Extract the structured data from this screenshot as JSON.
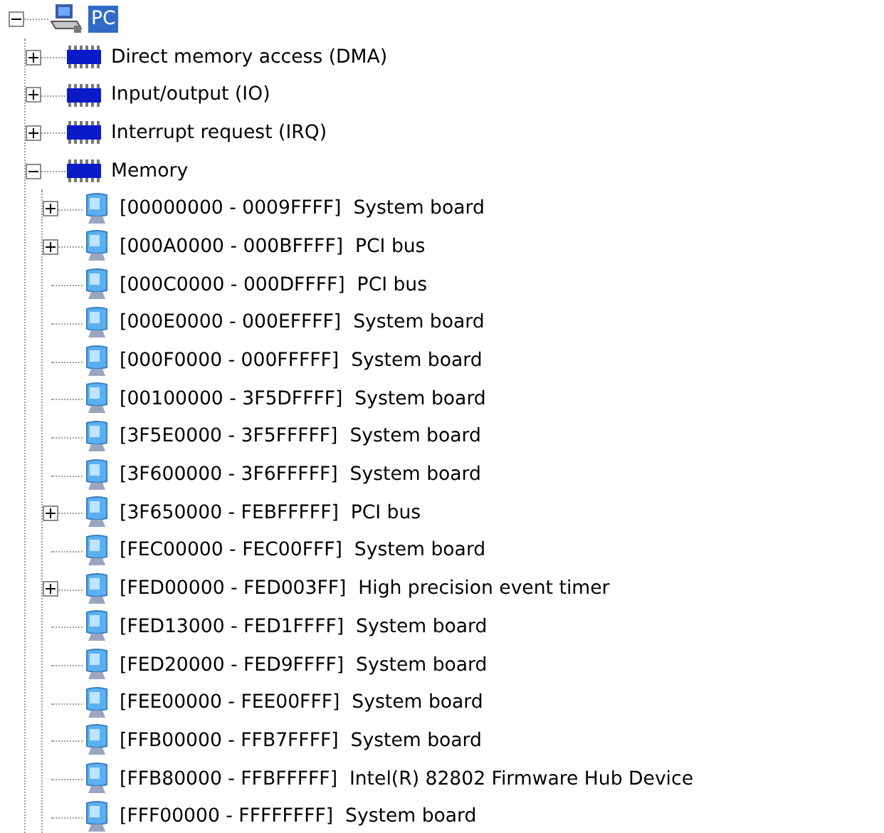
{
  "tree": [
    {
      "kind": "computer",
      "label": "PC",
      "selected": true,
      "expanded": true,
      "children": [
        {
          "kind": "category",
          "label": "Direct memory access (DMA)",
          "selected": false,
          "expanded": false
        },
        {
          "kind": "category",
          "label": "Input/output (IO)",
          "selected": false,
          "expanded": false
        },
        {
          "kind": "category",
          "label": "Interrupt request (IRQ)",
          "selected": false,
          "expanded": false
        },
        {
          "kind": "category",
          "label": "Memory",
          "selected": false,
          "expanded": true,
          "children": [
            {
              "kind": "resource",
              "label": "[00000000 - 0009FFFF]  System board",
              "selected": false,
              "expanded": false
            },
            {
              "kind": "resource",
              "label": "[000A0000 - 000BFFFF]  PCI bus",
              "selected": false,
              "expanded": false
            },
            {
              "kind": "resource",
              "label": "[000C0000 - 000DFFFF]  PCI bus",
              "selected": false
            },
            {
              "kind": "resource",
              "label": "[000E0000 - 000EFFFF]  System board",
              "selected": false
            },
            {
              "kind": "resource",
              "label": "[000F0000 - 000FFFFF]  System board",
              "selected": false
            },
            {
              "kind": "resource",
              "label": "[00100000 - 3F5DFFFF]  System board",
              "selected": false
            },
            {
              "kind": "resource",
              "label": "[3F5E0000 - 3F5FFFFF]  System board",
              "selected": false
            },
            {
              "kind": "resource",
              "label": "[3F600000 - 3F6FFFFF]  System board",
              "selected": false
            },
            {
              "kind": "resource",
              "label": "[3F650000 - FEBFFFFF]  PCI bus",
              "selected": false,
              "expanded": false
            },
            {
              "kind": "resource",
              "label": "[FEC00000 - FEC00FFF]  System board",
              "selected": false
            },
            {
              "kind": "resource",
              "label": "[FED00000 - FED003FF]  High precision event timer",
              "selected": false,
              "expanded": false
            },
            {
              "kind": "resource",
              "label": "[FED13000 - FED1FFFF]  System board",
              "selected": false
            },
            {
              "kind": "resource",
              "label": "[FED20000 - FED9FFFF]  System board",
              "selected": false
            },
            {
              "kind": "resource",
              "label": "[FEE00000 - FEE00FFF]  System board",
              "selected": false
            },
            {
              "kind": "resource",
              "label": "[FFB00000 - FFB7FFFF]  System board",
              "selected": false
            },
            {
              "kind": "resource",
              "label": "[FFB80000 - FFBFFFFF]  Intel(R) 82802 Firmware Hub Device",
              "selected": false
            },
            {
              "kind": "resource",
              "label": "[FFF00000 - FFFFFFFF]  System board",
              "selected": false
            }
          ]
        }
      ]
    }
  ]
}
